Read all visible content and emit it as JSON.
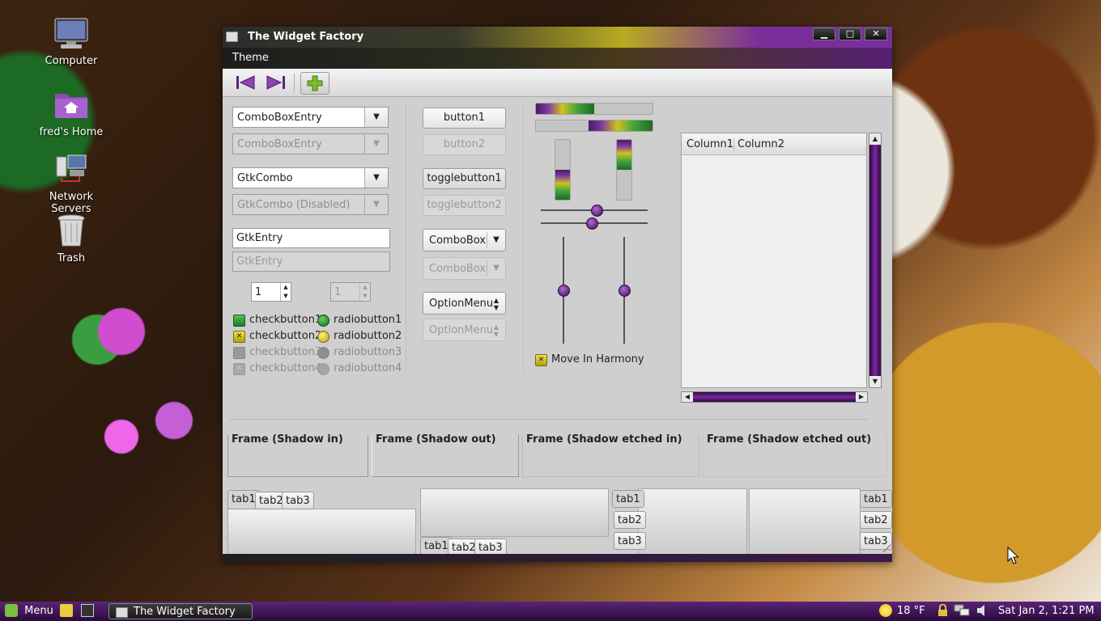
{
  "desktop": {
    "icons": [
      {
        "label": "Computer",
        "icon": "computer-icon"
      },
      {
        "label": "fred's Home",
        "icon": "home-folder-icon"
      },
      {
        "label": "Network Servers",
        "icon": "network-servers-icon"
      },
      {
        "label": "Trash",
        "icon": "trash-icon"
      }
    ]
  },
  "window": {
    "title": "The Widget Factory",
    "controls": {
      "minimize": "▁",
      "maximize": "□",
      "close": "✕"
    },
    "menu": [
      "Theme"
    ],
    "toolbar": {
      "icons": [
        "go-first-icon",
        "go-last-icon",
        "add-icon"
      ]
    },
    "column1": {
      "combo_entry": "ComboBoxEntry",
      "combo_entry_disabled": "ComboBoxEntry",
      "gtk_combo": "GtkCombo",
      "gtk_combo_disabled": "GtkCombo (Disabled)",
      "entry": "GtkEntry",
      "entry_disabled_placeholder": "GtkEntry",
      "spin_value": "1",
      "spin_disabled_value": "1",
      "checkbuttons": [
        "checkbutton1",
        "checkbutton2",
        "checkbutton3",
        "checkbutton4"
      ],
      "radiobuttons": [
        "radiobutton1",
        "radiobutton2",
        "radiobutton3",
        "radiobutton4"
      ]
    },
    "column2": {
      "button1": "button1",
      "button2": "button2",
      "toggle1": "togglebutton1",
      "toggle2": "togglebutton2",
      "combobox": "ComboBox",
      "combobox_disabled": "ComboBox",
      "optionmenu": "OptionMenu",
      "optionmenu_disabled": "OptionMenu"
    },
    "column3": {
      "progress_h1": 0.5,
      "progress_h2": 0.55,
      "progress_v1": 0.5,
      "progress_v2": 0.5,
      "scale_h1": 0.5,
      "scale_h2": 0.5,
      "scale_v1": 0.5,
      "scale_v2": 0.5,
      "harmony_label": "Move In Harmony"
    },
    "treeview": {
      "columns": [
        "Column1",
        "Column2"
      ]
    },
    "frames": [
      "Frame (Shadow in)",
      "Frame (Shadow out)",
      "Frame (Shadow etched in)",
      "Frame (Shadow etched out)"
    ],
    "notebooks": {
      "tabs": [
        "tab1",
        "tab2",
        "tab3"
      ]
    }
  },
  "taskbar": {
    "menu_label": "Menu",
    "task_title": "The Widget Factory",
    "weather": "18 °F",
    "clock": "Sat Jan  2,  1:21 PM"
  },
  "colors": {
    "accent_purple": "#7b27a0",
    "accent_yellow": "#cfc21e",
    "accent_green": "#45a53d"
  }
}
